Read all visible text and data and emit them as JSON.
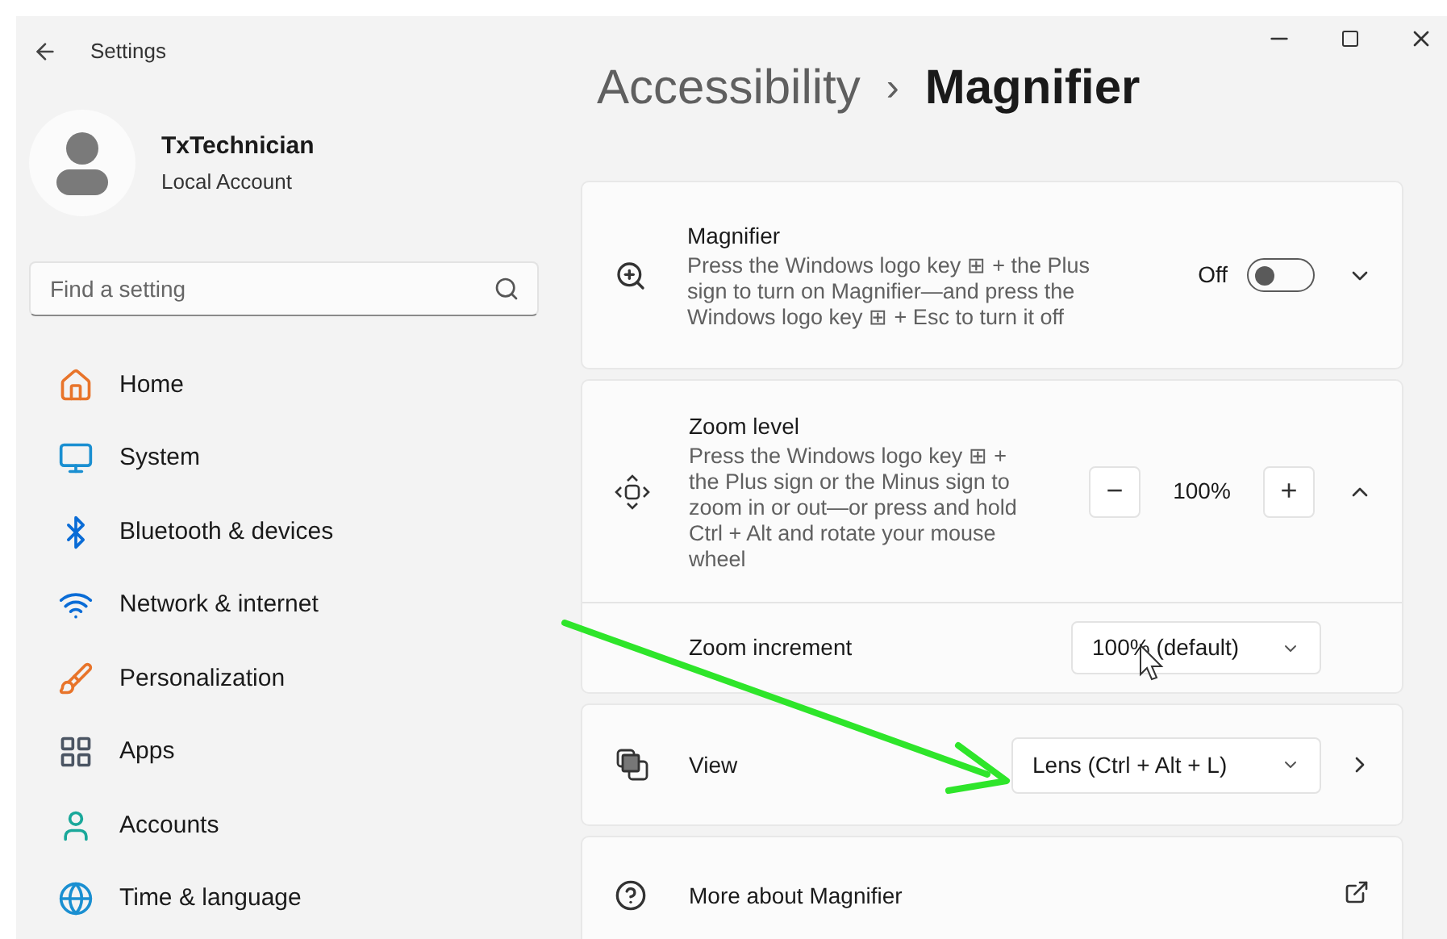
{
  "window": {
    "title": "Settings"
  },
  "account": {
    "name": "TxTechnician",
    "type": "Local Account"
  },
  "search": {
    "placeholder": "Find a setting"
  },
  "nav": [
    {
      "kind": "home",
      "label": "Home"
    },
    {
      "kind": "system",
      "label": "System"
    },
    {
      "kind": "bluetooth",
      "label": "Bluetooth & devices"
    },
    {
      "kind": "network",
      "label": "Network & internet"
    },
    {
      "kind": "personalization",
      "label": "Personalization"
    },
    {
      "kind": "apps",
      "label": "Apps"
    },
    {
      "kind": "accounts",
      "label": "Accounts"
    },
    {
      "kind": "time",
      "label": "Time & language"
    }
  ],
  "breadcrumb": {
    "parent": "Accessibility",
    "separator": "›",
    "current": "Magnifier"
  },
  "magnifier": {
    "title": "Magnifier",
    "description": "Press the Windows logo key ⊞ + the Plus sign to turn on Magnifier—and press the Windows logo key ⊞ + Esc to turn it off",
    "state_label": "Off",
    "on": false,
    "expanded": false
  },
  "zoom_level": {
    "title": "Zoom level",
    "description": "Press the Windows logo key ⊞ + the Plus sign or the Minus sign to zoom in or out—or press and hold Ctrl + Alt and rotate your mouse wheel",
    "minus": "−",
    "value": "100%",
    "plus": "+",
    "expanded": true,
    "increment": {
      "label": "Zoom increment",
      "value": "100% (default)"
    }
  },
  "view": {
    "label": "View",
    "value": "Lens (Ctrl + Alt + L)"
  },
  "more": {
    "label": "More about Magnifier"
  }
}
